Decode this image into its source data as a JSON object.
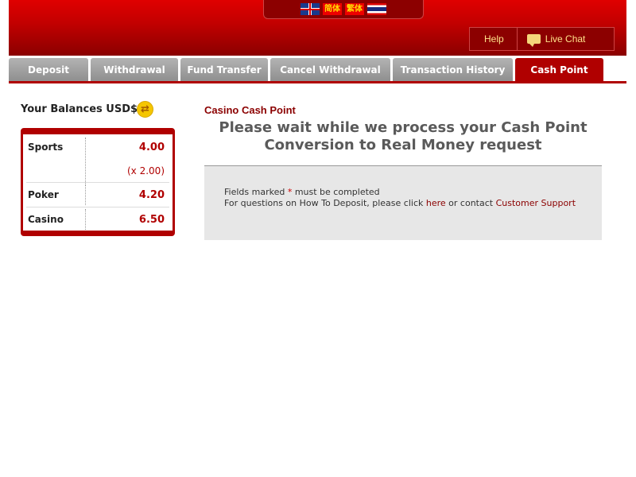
{
  "header": {
    "languages": [
      {
        "name": "English",
        "icon": "uk-flag-icon"
      },
      {
        "name": "简体",
        "icon": "simplified-chinese-flag-icon"
      },
      {
        "name": "繁体",
        "icon": "traditional-chinese-flag-icon"
      },
      {
        "name": "Thai",
        "icon": "thai-flag-icon"
      }
    ],
    "help_label": "Help",
    "live_chat_label": "Live Chat"
  },
  "tabs": [
    {
      "label": "Deposit",
      "active": false
    },
    {
      "label": "Withdrawal",
      "active": false
    },
    {
      "label": "Fund Transfer",
      "active": false
    },
    {
      "label": "Cancel Withdrawal",
      "active": false
    },
    {
      "label": "Transaction History",
      "active": false
    },
    {
      "label": "Cash Point",
      "active": true
    }
  ],
  "balances": {
    "title": "Your Balances USD$",
    "rows": [
      {
        "label": "Sports",
        "value": "4.00",
        "multiplier": "(x 2.00)"
      },
      {
        "label": "Poker",
        "value": "4.20"
      },
      {
        "label": "Casino",
        "value": "6.50"
      }
    ]
  },
  "main": {
    "section_title": "Casino Cash Point",
    "headline_line1": "Please wait while we process your Cash Point",
    "headline_line2": "Conversion to Real Money request",
    "fields_prefix": "Fields marked",
    "required_mark": "*",
    "fields_suffix": "must be completed",
    "questions_prefix": "For questions on How To Deposit, please click",
    "here_link": "here",
    "or_contact": "or contact",
    "support_link": "Customer Support"
  },
  "colors": {
    "brand_red": "#b00000",
    "header_gradient_top": "#e00000",
    "link_gold": "#ffe28a"
  }
}
